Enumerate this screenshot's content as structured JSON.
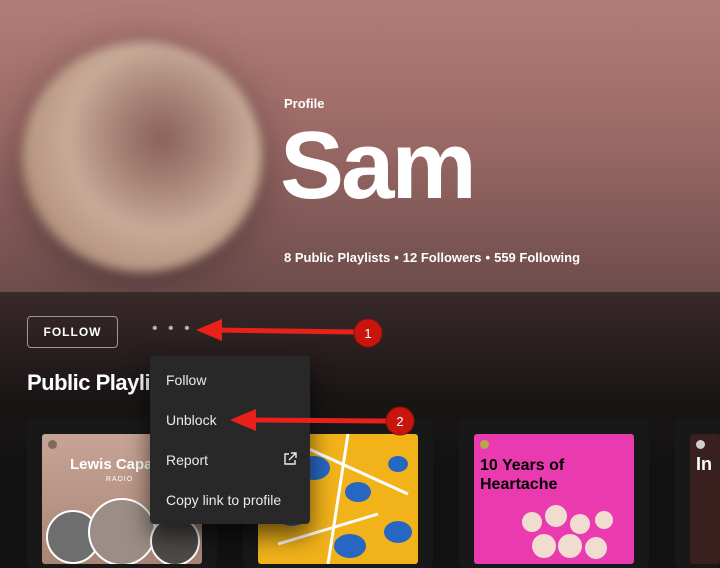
{
  "profile": {
    "label": "Profile",
    "name": "Sam",
    "stats": [
      "8 Public Playlists",
      "12 Followers",
      "559 Following"
    ]
  },
  "actions": {
    "follow_label": "FOLLOW",
    "more_label": "• • •"
  },
  "section": {
    "title": "Public Playlists"
  },
  "menu": {
    "items": [
      "Follow",
      "Unblock",
      "Report",
      "Copy link to profile"
    ]
  },
  "cards": [
    {
      "title": "Lewis Capaldi",
      "subtitle": "RADIO"
    },
    {
      "title": ""
    },
    {
      "title": "10 Years of Heartache"
    },
    {
      "title": "In"
    }
  ],
  "annotations": [
    "1",
    "2"
  ],
  "colors": {
    "accent_red": "#e8221b",
    "menu_bg": "#282828",
    "card_pink": "#ea3ab0",
    "card_yellow": "#f1b21a"
  }
}
